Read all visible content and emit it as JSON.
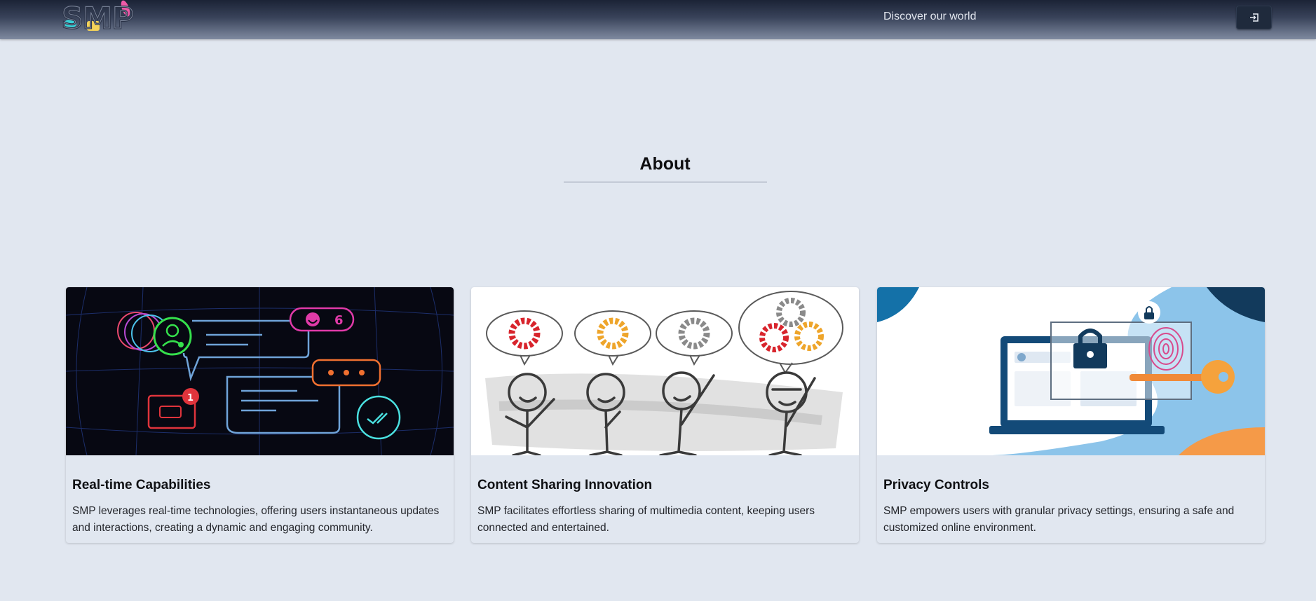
{
  "brand": {
    "logo_text": "SMP"
  },
  "nav": {
    "link_label": "Discover our world",
    "login_icon": "login-icon"
  },
  "about": {
    "title": "About",
    "cards": [
      {
        "title": "Real-time Capabilities",
        "text": "SMP leverages real-time technologies, offering users instantaneous updates and interactions, creating a dynamic and engaging community.",
        "image": {
          "notification_count": "1",
          "reaction_count": "6"
        }
      },
      {
        "title": "Content Sharing Innovation",
        "text": "SMP facilitates effortless sharing of multimedia content, keeping users connected and entertained."
      },
      {
        "title": "Privacy Controls",
        "text": "SMP empowers users with granular privacy settings, ensuring a safe and customized online environment."
      }
    ]
  },
  "colors": {
    "page_bg": "#e1e7f0",
    "nav_dark": "#1b2336",
    "button_bg": "#1f2a3c"
  }
}
